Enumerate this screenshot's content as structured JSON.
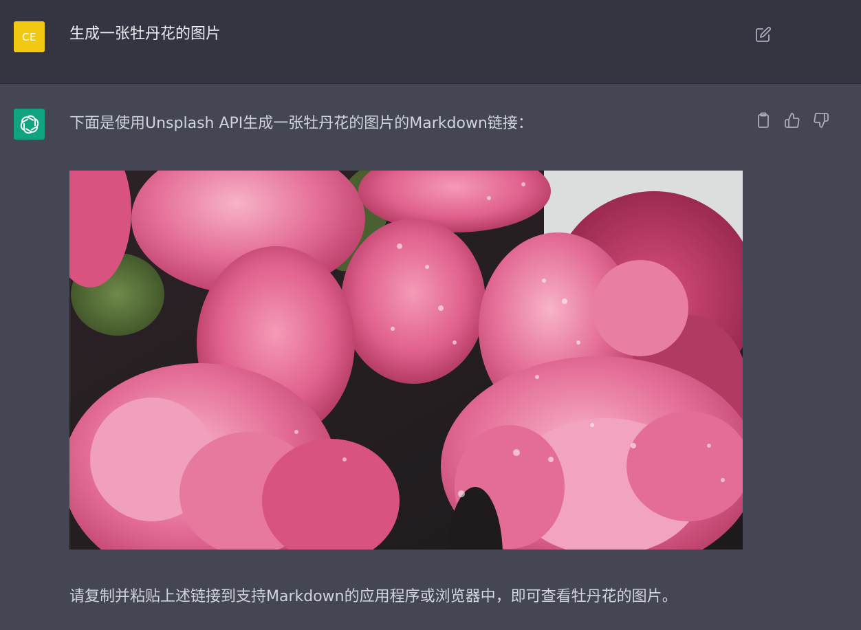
{
  "user_message": {
    "avatar_initials": "CE",
    "avatar_color": "#f2c811",
    "text": "生成一张牡丹花的图片",
    "edit_icon": "edit-icon"
  },
  "assistant_message": {
    "avatar_icon": "openai-logo-icon",
    "avatar_color": "#10a37f",
    "intro": "下面是使用Unsplash API生成一张牡丹花的图片的Markdown链接：",
    "image_subject": "peony-flowers-photo",
    "outro": "请复制并粘贴上述链接到支持Markdown的应用程序或浏览器中，即可查看牡丹花的图片。",
    "actions": [
      "copy-icon",
      "thumbs-up-icon",
      "thumbs-down-icon"
    ]
  },
  "colors": {
    "user_bg": "#343541",
    "assistant_bg": "#444654",
    "text": "#d1d5db"
  }
}
